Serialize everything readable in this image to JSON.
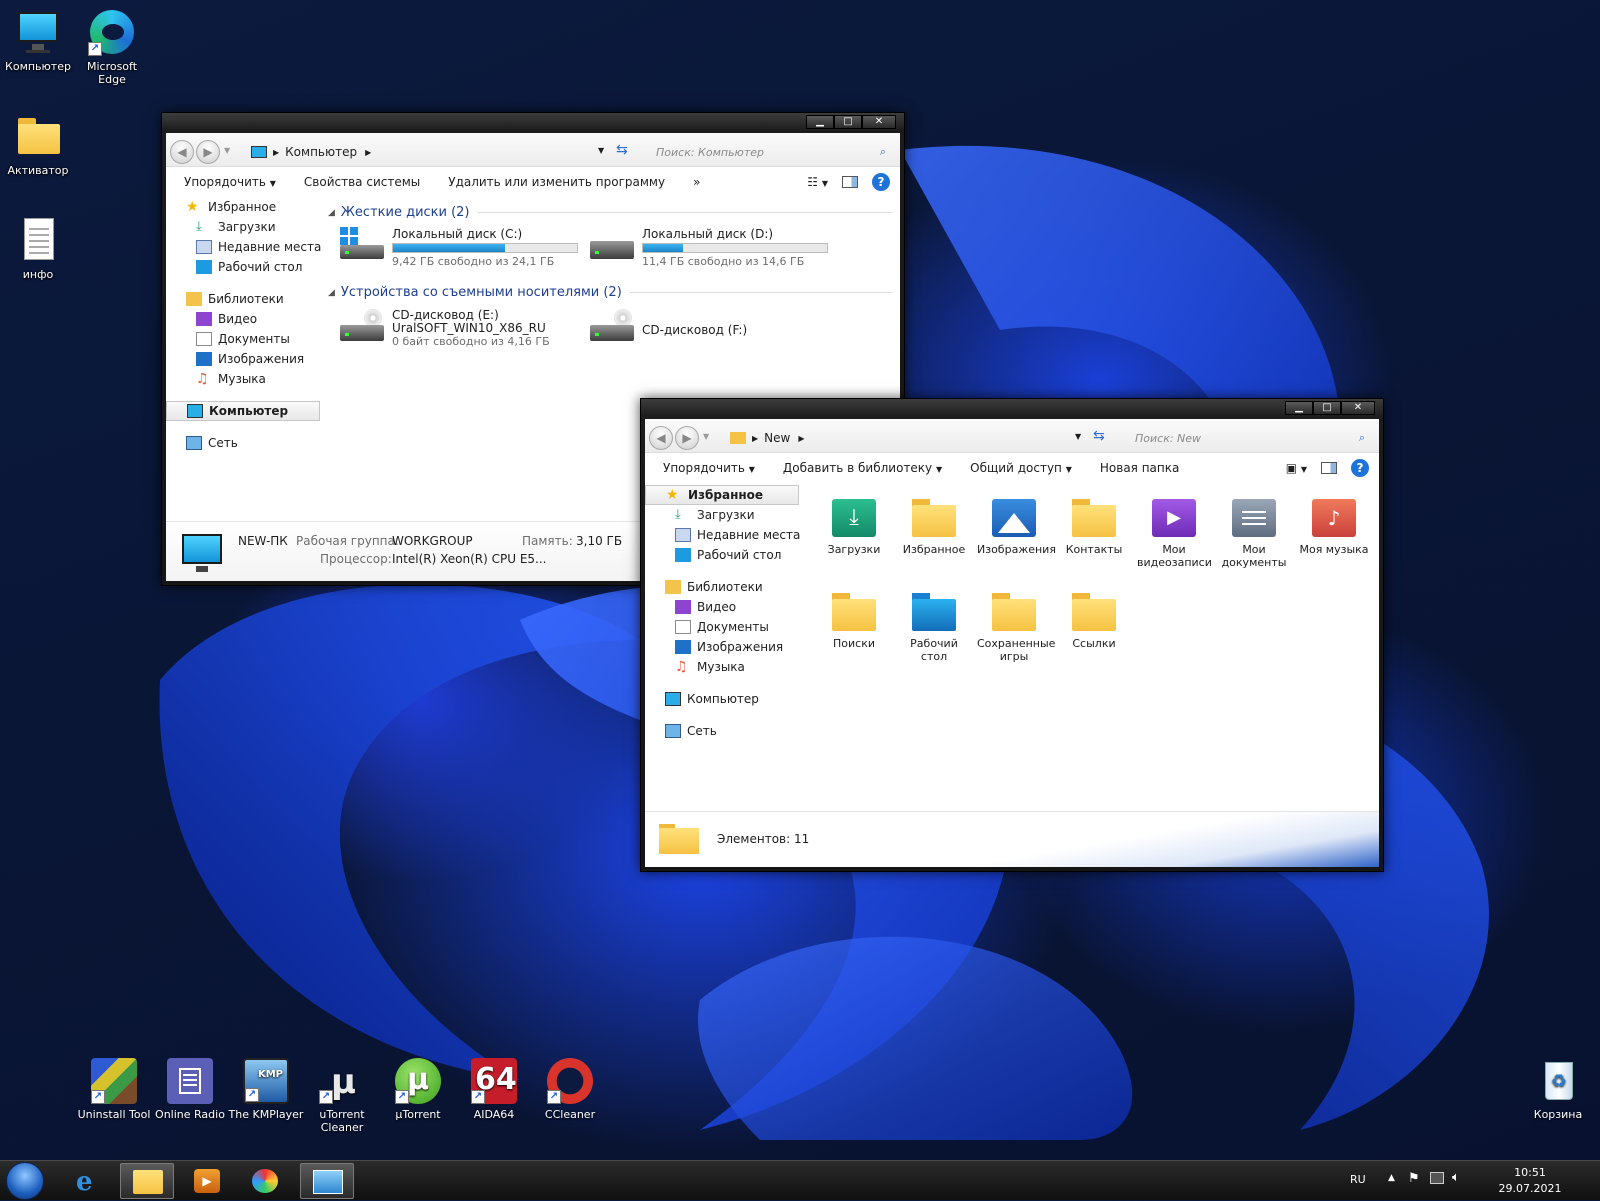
{
  "desktop": {
    "icons": [
      {
        "label": "Компьютер"
      },
      {
        "label": "Microsoft Edge"
      },
      {
        "label": "Активатор"
      },
      {
        "label": "инфо"
      }
    ],
    "bottom_icons": [
      {
        "label": "Uninstall Tool"
      },
      {
        "label": "Online Radio"
      },
      {
        "label": "The KMPlayer"
      },
      {
        "label": "uTorrent Cleaner"
      },
      {
        "label": "µTorrent"
      },
      {
        "label": "AIDA64"
      },
      {
        "label": "CCleaner"
      }
    ],
    "recycle_bin": "Корзина"
  },
  "window1": {
    "address": "Компьютер",
    "search_placeholder": "Поиск: Компьютер",
    "toolbar": {
      "organize": "Упорядочить",
      "system_properties": "Свойства системы",
      "uninstall": "Удалить или изменить программу",
      "more": "»"
    },
    "nav": {
      "favorites": "Избранное",
      "downloads": "Загрузки",
      "recent": "Недавние места",
      "desktop": "Рабочий стол",
      "libraries": "Библиотеки",
      "video": "Видео",
      "documents": "Документы",
      "images": "Изображения",
      "music": "Музыка",
      "computer": "Компьютер",
      "network": "Сеть"
    },
    "hard_drives_header": "Жесткие диски (2)",
    "removable_header": "Устройства со съемными носителями (2)",
    "drives": [
      {
        "name": "Локальный диск (C:)",
        "free": "9,42 ГБ свободно из 24,1 ГБ",
        "used_fraction": 0.61
      },
      {
        "name": "Локальный диск (D:)",
        "free": "11,4 ГБ свободно из 14,6 ГБ",
        "used_fraction": 0.22
      }
    ],
    "cd": [
      {
        "name": "CD-дисковод (E:)",
        "label": "UralSOFT_WIN10_X86_RU",
        "free": "0 байт свободно из 4,16 ГБ"
      },
      {
        "name": "CD-дисковод (F:)"
      }
    ],
    "status": {
      "pc_name": "NEW-ПК",
      "workgroup_label": "Рабочая группа:",
      "workgroup": "WORKGROUP",
      "memory_label": "Память:",
      "memory": "3,10 ГБ",
      "cpu_label": "Процессор:",
      "cpu": "Intel(R) Xeon(R) CPU E5..."
    }
  },
  "window2": {
    "address": "New",
    "search_placeholder": "Поиск: New",
    "toolbar": {
      "organize": "Упорядочить",
      "add_library": "Добавить в библиотеку",
      "share": "Общий доступ",
      "new_folder": "Новая папка"
    },
    "nav": {
      "favorites": "Избранное",
      "downloads": "Загрузки",
      "recent": "Недавние места",
      "desktop": "Рабочий стол",
      "libraries": "Библиотеки",
      "video": "Видео",
      "documents": "Документы",
      "images": "Изображения",
      "music": "Музыка",
      "computer": "Компьютер",
      "network": "Сеть"
    },
    "items": [
      {
        "label": "Загрузки"
      },
      {
        "label": "Избранное"
      },
      {
        "label": "Изображения"
      },
      {
        "label": "Контакты"
      },
      {
        "label": "Мои видеозаписи"
      },
      {
        "label": "Мои документы"
      },
      {
        "label": "Моя музыка"
      },
      {
        "label": "Поиски"
      },
      {
        "label": "Рабочий стол"
      },
      {
        "label": "Сохраненные игры"
      },
      {
        "label": "Ссылки"
      }
    ],
    "status": "Элементов: 11"
  },
  "taskbar": {
    "lang": "RU",
    "time": "10:51",
    "date": "29.07.2021"
  }
}
